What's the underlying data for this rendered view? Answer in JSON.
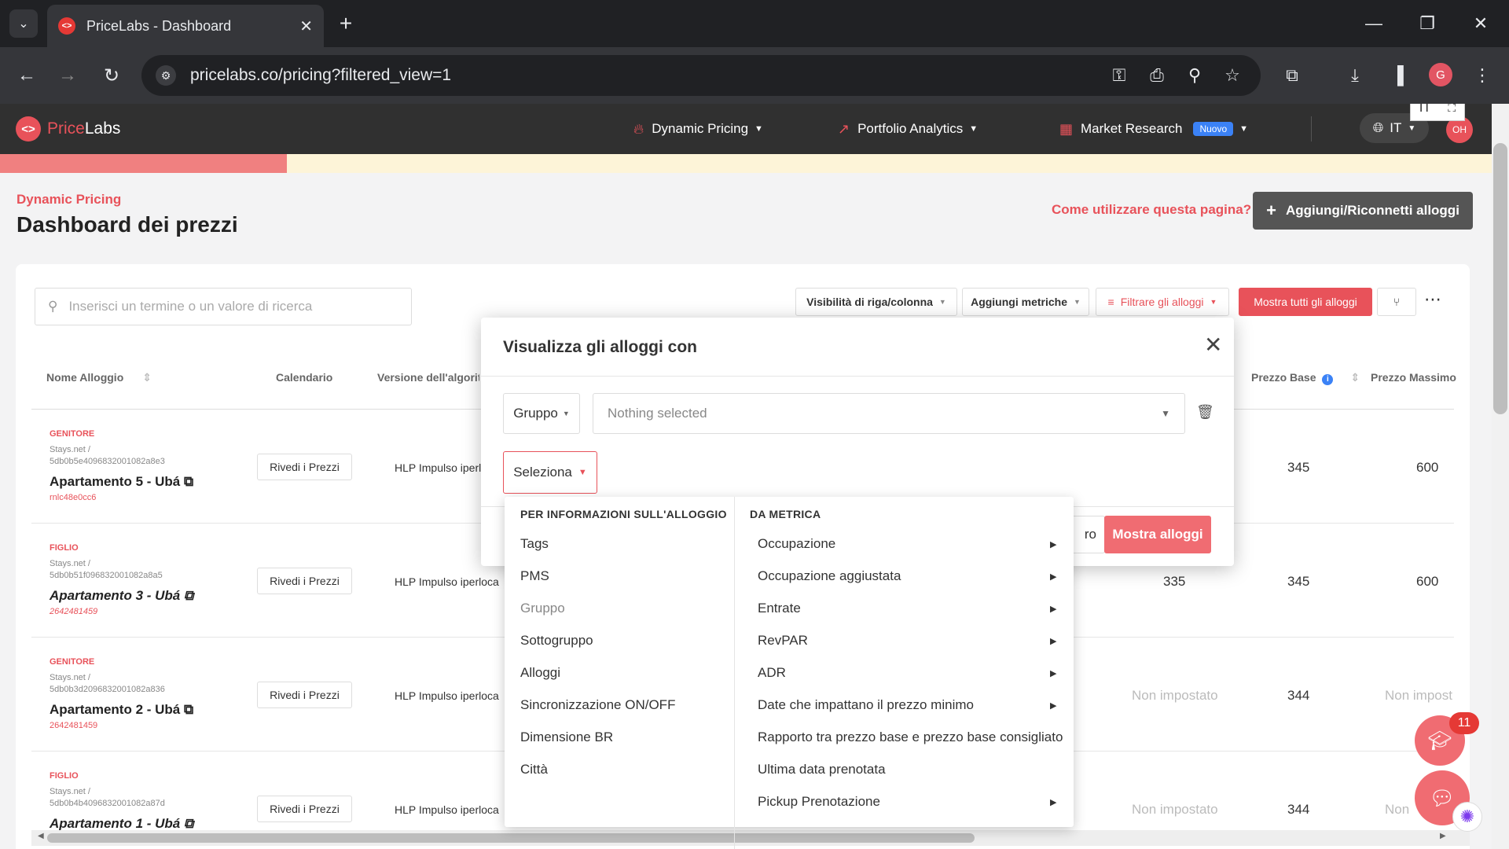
{
  "browser": {
    "tab_title": "PriceLabs - Dashboard",
    "url": "pricelabs.co/pricing?filtered_view=1",
    "profile_initial": "G",
    "lang_popup": "IT"
  },
  "app": {
    "logo_price": "Price",
    "logo_labs": "Labs",
    "nav": [
      {
        "label": "Dynamic Pricing",
        "icon": "flame-icon"
      },
      {
        "label": "Portfolio Analytics",
        "icon": "trend-icon"
      },
      {
        "label": "Market Research",
        "icon": "grid-icon",
        "badge": "Nuovo"
      }
    ],
    "lang": "IT",
    "avatar": "OH"
  },
  "header": {
    "breadcrumb": "Dynamic Pricing",
    "title": "Dashboard dei prezzi",
    "howto": "Come utilizzare questa pagina?",
    "add_button": "Aggiungi/Riconnetti alloggi"
  },
  "toolbar": {
    "search_placeholder": "Inserisci un termine o un valore di ricerca",
    "visibility": "Visibilità di riga/colonna",
    "metrics": "Aggiungi metriche",
    "filter": "Filtrare gli alloggi",
    "show_all": "Mostra tutti gli alloggi"
  },
  "table": {
    "headers": [
      "Nome Alloggio",
      "Calendario",
      "Versione dell'algoritmo",
      "Prezzo Base",
      "Prezzo Massimo"
    ],
    "review_label": "Rivedi i Prezzi",
    "rows": [
      {
        "tag": "GENITORE",
        "src1": "Stays.net /",
        "src2": "5db0b5e4096832001082a8e3",
        "name": "Apartamento 5 - Ubá",
        "id": "rnlc48e0cc6",
        "algo": "HLP Impulso iperl",
        "min": "",
        "base": "345",
        "max": "600"
      },
      {
        "tag": "FIGLIO",
        "src1": "Stays.net /",
        "src2": "5db0b51f096832001082a8a5",
        "name": "Apartamento 3 - Ubá",
        "id": "2642481459",
        "algo": "HLP Impulso iperloca",
        "min": "335",
        "base": "345",
        "max": "600"
      },
      {
        "tag": "GENITORE",
        "src1": "Stays.net /",
        "src2": "5db0b3d2096832001082a836",
        "name": "Apartamento 2 - Ubá",
        "id": "2642481459",
        "algo": "HLP Impulso iperloca",
        "min": "Non impostato",
        "base": "344",
        "max": "Non impost"
      },
      {
        "tag": "FIGLIO",
        "src1": "Stays.net /",
        "src2": "5db0b4b4096832001082a87d",
        "name": "Apartamento 1 - Ubá",
        "id": "",
        "algo": "HLP Impulso iperloca",
        "min": "Non impostato",
        "base": "344",
        "max": "Non"
      }
    ]
  },
  "modal": {
    "title": "Visualizza gli alloggi con",
    "group_select": "Gruppo",
    "multi_placeholder": "Nothing selected",
    "select_label": "Seleziona",
    "reset_partial": "ro",
    "submit": "Mostra alloggi"
  },
  "menu": {
    "left_header": "PER INFORMAZIONI SULL'ALLOGGIO",
    "left_items": [
      "Tags",
      "PMS",
      "Gruppo",
      "Sottogruppo",
      "Alloggi",
      "Sincronizzazione ON/OFF",
      "Dimensione BR",
      "Città"
    ],
    "right_header": "DA METRICA",
    "right_items": [
      "Occupazione",
      "Occupazione aggiustata",
      "Entrate",
      "RevPAR",
      "ADR",
      "Date che impattano il prezzo minimo",
      "Rapporto tra prezzo base e prezzo base consigliato",
      "Ultima data prenotata",
      "Pickup Prenotazione"
    ]
  },
  "floats": {
    "notif_count": "11"
  }
}
